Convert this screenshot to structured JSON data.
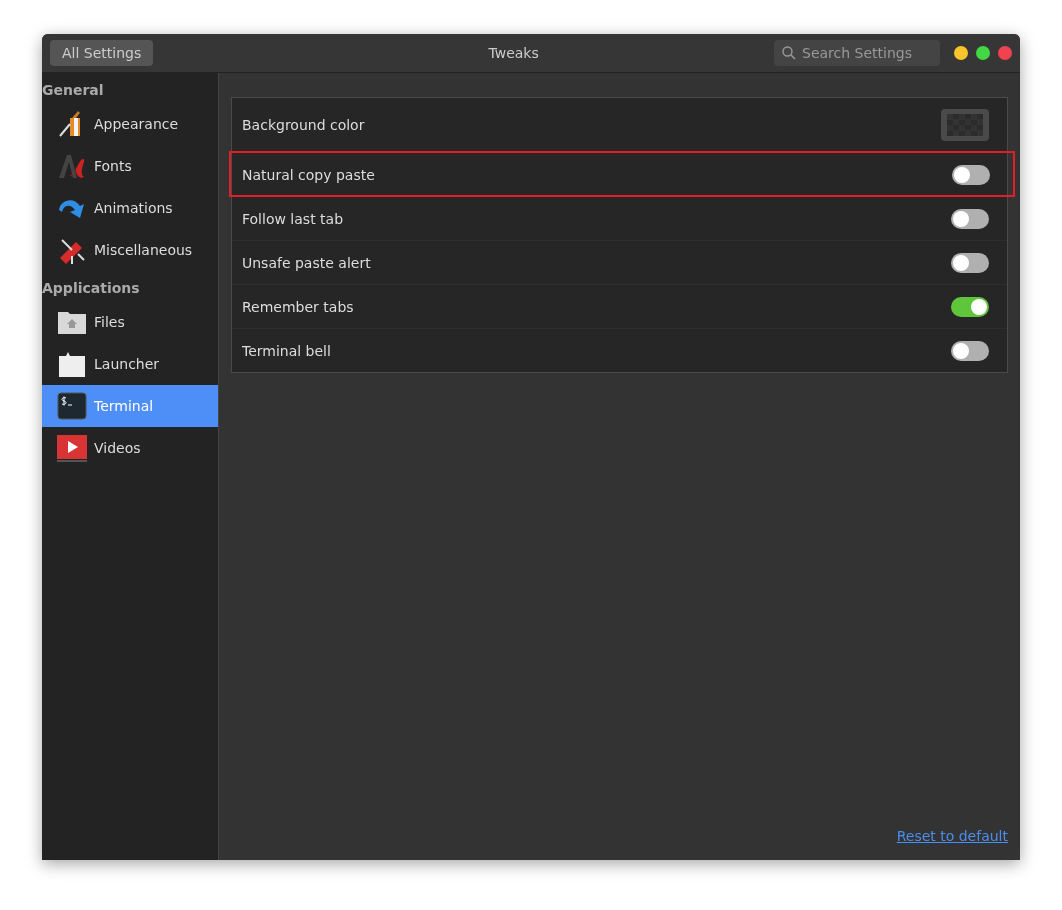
{
  "window": {
    "title": "Tweaks"
  },
  "all_settings_button": "All Settings",
  "search": {
    "placeholder": "Search Settings"
  },
  "sidebar": {
    "sections": [
      {
        "title": "General",
        "items": [
          {
            "label": "Appearance",
            "selected": false
          },
          {
            "label": "Fonts",
            "selected": false
          },
          {
            "label": "Animations",
            "selected": false
          },
          {
            "label": "Miscellaneous",
            "selected": false
          }
        ]
      },
      {
        "title": "Applications",
        "items": [
          {
            "label": "Files",
            "selected": false
          },
          {
            "label": "Launcher",
            "selected": false
          },
          {
            "label": "Terminal",
            "selected": true
          },
          {
            "label": "Videos",
            "selected": false
          }
        ]
      }
    ]
  },
  "settings": [
    {
      "kind": "color",
      "label": "Background color",
      "highlighted": false
    },
    {
      "kind": "switch",
      "label": "Natural copy paste",
      "on": false,
      "highlighted": true
    },
    {
      "kind": "switch",
      "label": "Follow last tab",
      "on": false,
      "highlighted": false
    },
    {
      "kind": "switch",
      "label": "Unsafe paste alert",
      "on": false,
      "highlighted": false
    },
    {
      "kind": "switch",
      "label": "Remember tabs",
      "on": true,
      "highlighted": false
    },
    {
      "kind": "switch",
      "label": "Terminal bell",
      "on": false,
      "highlighted": false
    }
  ],
  "reset_link": "Reset to default"
}
